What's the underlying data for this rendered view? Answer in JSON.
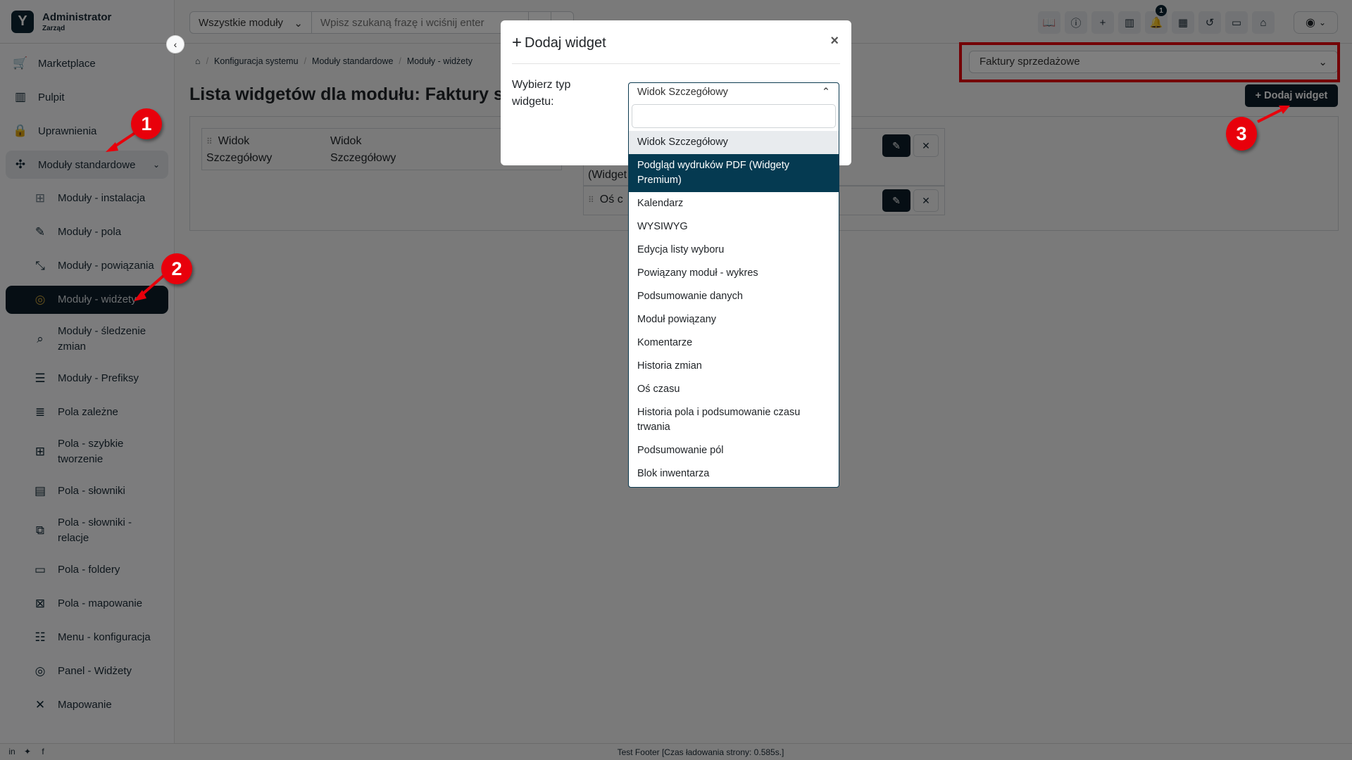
{
  "brand": {
    "name": "Administrator",
    "subtitle": "Zarząd"
  },
  "sidebar": {
    "items": [
      {
        "label": "Marketplace",
        "icon": "cart-icon"
      },
      {
        "label": "Pulpit",
        "icon": "dashboard-icon"
      },
      {
        "label": "Uprawnienia",
        "icon": "lock-icon"
      },
      {
        "label": "Moduły standardowe",
        "icon": "puzzle-icon",
        "expanded": true
      }
    ],
    "subitems": [
      {
        "label": "Moduły - instalacja",
        "icon": "puzzle-grid-icon"
      },
      {
        "label": "Moduły - pola",
        "icon": "puzzle-edit-icon"
      },
      {
        "label": "Moduły - powiązania",
        "icon": "puzzle-link-icon"
      },
      {
        "label": "Moduły - widżety",
        "icon": "puzzle-widget-icon",
        "active": true
      },
      {
        "label": "Moduły - śledzenie zmian",
        "icon": "puzzle-search-icon"
      },
      {
        "label": "Moduły - Prefiksy",
        "icon": "list-check-icon"
      },
      {
        "label": "Pola zależne",
        "icon": "list-icon"
      },
      {
        "label": "Pola - szybkie tworzenie",
        "icon": "window-plus-icon"
      },
      {
        "label": "Pola - słowniki",
        "icon": "window-list-icon"
      },
      {
        "label": "Pola - słowniki - relacje",
        "icon": "window-arrows-icon"
      },
      {
        "label": "Pola - foldery",
        "icon": "window-folder-icon"
      },
      {
        "label": "Pola - mapowanie",
        "icon": "window-map-icon"
      },
      {
        "label": "Menu - konfiguracja",
        "icon": "menu-list-icon"
      },
      {
        "label": "Panel - Widżety",
        "icon": "panel-widget-icon"
      },
      {
        "label": "Mapowanie",
        "icon": "compress-icon"
      }
    ]
  },
  "header": {
    "search_module": "Wszystkie moduły",
    "search_placeholder": "Wpisz szukaną frazę i wciśnij enter",
    "icons": [
      "book-icon",
      "info-icon",
      "plus-icon",
      "library-icon",
      "bell-icon",
      "calendar-icon",
      "history-icon",
      "video-icon",
      "home-icon"
    ],
    "notification_count": "1"
  },
  "breadcrumb": [
    "Konfiguracja systemu",
    "Moduły standardowe",
    "Moduły - widżety"
  ],
  "page": {
    "title": "Lista widgetów dla modułu: Faktury sprzedażowe",
    "module_select": "Faktury sprzedażowe",
    "add_button": "Dodaj widget",
    "columns": [
      {
        "widgets": [
          {
            "type": "Widok Szczegółowy",
            "name": "Widok Szczegółowy"
          }
        ]
      },
      {
        "widgets": [
          {
            "type": "(Widget",
            "name": ""
          },
          {
            "type": "Oś c",
            "name": ""
          }
        ]
      }
    ]
  },
  "modal": {
    "title": "Dodaj widget",
    "label": "Wybierz typ widgetu:",
    "selected": "Widok Szczegółowy",
    "search_value": "",
    "options": [
      "Widok Szczegółowy",
      "Podgląd wydruków PDF (Widgety Premium)",
      "Kalendarz",
      "WYSIWYG",
      "Edycja listy wyboru",
      "Powiązany moduł - wykres",
      "Podsumowanie danych",
      "Moduł powiązany",
      "Komentarze",
      "Historia zmian",
      "Oś czasu",
      "Historia pola i podsumowanie czasu trwania",
      "Podsumowanie pól",
      "Blok inwentarza"
    ],
    "highlighted_index": 1
  },
  "annotations": [
    "1",
    "2",
    "3"
  ],
  "footer": {
    "text": "Test Footer [Czas ładowania strony: 0.585s.]"
  },
  "colors": {
    "brand_dark": "#0c1d29",
    "highlight": "#053a51",
    "annotation_red": "#e8000b",
    "active_icon": "#c7a13a"
  }
}
